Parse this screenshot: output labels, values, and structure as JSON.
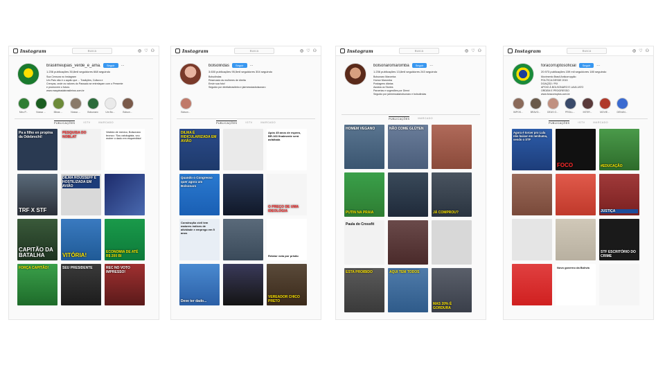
{
  "panels": [
    {
      "app": "Instagram",
      "search": "Busca",
      "username": "brasilmeupais_verde_e_ama...",
      "follow": "Seguir",
      "stats": "1.236 publicações   30,8mil seguidores   668 seguindo",
      "bio": "Sua Censura no Instagram\nUm País não é o aquilo que ... Tradições, Cultura e\nCrenças, onde os valores do Passado se entrelaçam com o Presente\ne promovem o futuro.\nwww.maquinadabrasileiros.com.br",
      "highlights": [
        "Meu P...",
        "Nossa ...",
        "Minas ...",
        "Nossa ...",
        "Bolsonaro",
        "Um Bo...",
        "Bolson..."
      ],
      "tabs": [
        "PUBLICAÇÕES",
        "IGTV",
        "MARCADO"
      ],
      "tiles": [
        {
          "text": "Pa a filho en propina da Odebrecht!",
          "bg": "#2a3a52"
        },
        {
          "text": "PESQUISA DO NOBLAT",
          "bg": "#f2f2f2"
        },
        {
          "text": "Vestido de mexico, Bolsonaro bronco: 'Sou ustologista, vou mober o dado em esquerdista'",
          "bg": "#ffffff"
        },
        {
          "text": "TRF X STF",
          "bg": "#3a3f4a"
        },
        {
          "text": "DILMA ROUSSEFF É HOSTILIZADA EM AVIÃO",
          "bg": "#d9d9d9"
        },
        {
          "text": "",
          "bg": "#1d2b6b"
        },
        {
          "text": "CAPITÃO DA BATALHA",
          "bg": "#1e3320"
        },
        {
          "text": "VITÓRIA!",
          "bg": "#1f5a96"
        },
        {
          "text": "ECONOMIA DE ATÉ R$ 200 BI",
          "bg": "#0d7a3a"
        },
        {
          "text": "FORÇA CAPITÃO!",
          "bg": "#2e8b3a"
        },
        {
          "text": "SEU PRESIDENTE",
          "bg": "#1c1c1c"
        },
        {
          "text": "REC NO VOTO IMPRESSO!",
          "bg": "#7a2020"
        }
      ]
    },
    {
      "app": "Instagram",
      "search": "Busca",
      "username": "bolsolindas",
      "follow": "Seguir",
      "stats": "3.630 publicações   95,5mil seguidores   304 seguindo",
      "bio": "Bolsolindas\nReservado às mulheres de direita\nEnvie sua foto!\nSeguido por direitabrasileira e jairmessiasbolsonaro",
      "highlights": [
        "Bolson..."
      ],
      "tabs": [
        "PUBLICAÇÕES",
        "IGTV",
        "MARCADO"
      ],
      "tiles": [
        {
          "text": "DILMA É RIDICULARIZADA EM AVIÃO",
          "bg": "#1e3a6b"
        },
        {
          "text": "",
          "bg": "#eaeaea"
        },
        {
          "text": "Após 45 anos de espera, BR-163 finalmente será asfaltada",
          "bg": "#ffffff"
        },
        {
          "text": "Quando o Congresso quer agora um Bolsonaro",
          "bg": "#1a5fb4"
        },
        {
          "text": "",
          "bg": "#101828"
        },
        {
          "text": "O PREÇO DE UMA IDEOLOGIA",
          "bg": "#f5f5f5"
        },
        {
          "text": "Construção civil tem maiores índices de atividade e emprego em 5 anos",
          "bg": "#e8eef5"
        },
        {
          "text": "",
          "bg": "#3a4a5a"
        },
        {
          "text": "Relator vota por prisão",
          "bg": "#ffffff"
        },
        {
          "text": "Deve ter dado...",
          "bg": "#2b5fa6"
        },
        {
          "text": "",
          "bg": "#141414"
        },
        {
          "text": "VEREADOR CHICO PRETO",
          "bg": "#3b2a1a"
        }
      ]
    },
    {
      "app": "Instagram",
      "search": "Busca",
      "username": "bolsonaromaromba",
      "follow": "Seguir",
      "stats": "1.236 publicações   13,8mil seguidores   243 seguindo",
      "bio": "Bolsonaro Maromba\nHumor Maromba\nPostagens diárias\nAssista os Stories\nParcerias e sugestões por Direct\nSeguido por jairmessiasbolsonaro e bolsolindas",
      "highlights": [],
      "tabs": [
        "PUBLICAÇÕES",
        "MARCADO"
      ],
      "tiles": [
        {
          "text": "HOMEM VEGANO",
          "bg": "#3a5570"
        },
        {
          "text": "NÃO COME GLÚTEN",
          "bg": "#4a5d7a"
        },
        {
          "text": "",
          "bg": "#8a4a3a"
        },
        {
          "text": "PUTIN NA PRAIA",
          "bg": "#2e7d32"
        },
        {
          "text": "",
          "bg": "#1f2a3a"
        },
        {
          "text": "JÁ COMPROU?",
          "bg": "#2a3440"
        },
        {
          "text": "Paula do Crossfit",
          "bg": "#f2f2f2"
        },
        {
          "text": "",
          "bg": "#4a2a2a"
        },
        {
          "text": "",
          "bg": "#d8d8d8"
        },
        {
          "text": "ESTA PROIBIDO",
          "bg": "#3a3a3a"
        },
        {
          "text": "AQUI TEM TODOS",
          "bg": "#2f5b8a"
        },
        {
          "text": "MAS 20% É GORDURA",
          "bg": "#3a3f4a"
        }
      ]
    },
    {
      "app": "Instagram",
      "search": "Busca",
      "username": "foracorruptosoficial",
      "follow": "Seguir",
      "stats": "20.973 publicações   159 mil seguidores   180 seguindo",
      "bio": "Movimento Brasil Anticorrupção\nPOLÍTICA DESDE 2015\nDOAÇÃO / PIX\nAPOIO À BOLSONARO E LAVA JATO\nORDEM E PROGRESSO\nwww.foracorruptos.com.br",
      "highlights": [
        "IMPOS...",
        "BRAVO...",
        "DEUS O...",
        "PROLL...",
        "INTER...",
        "MOVIE...",
        "DENUN..."
      ],
      "tabs": [
        "PUBLICAÇÕES",
        "IGTV",
        "MARCADO"
      ],
      "tiles": [
        {
          "text": "Agora é torcer pro Lula não baixar em nenhuma, sendo o STF",
          "bg": "#1d3d7a"
        },
        {
          "text": "FOCO",
          "bg": "#111111"
        },
        {
          "text": "#EDUCAÇÃO",
          "bg": "#2d6b2a"
        },
        {
          "text": "",
          "bg": "#7a4a3a"
        },
        {
          "text": "",
          "bg": "#c0392b"
        },
        {
          "text": "JUSTIÇA",
          "bg": "#7a2020"
        },
        {
          "text": "",
          "bg": "#e5e5e5"
        },
        {
          "text": "",
          "bg": "#b8b0a0"
        },
        {
          "text": "STF ESCRITÓRIO DO CRIME",
          "bg": "#1a1a1a"
        },
        {
          "text": "",
          "bg": "#d02020"
        },
        {
          "text": "Novo governo da Bolívia",
          "bg": "#ffffff"
        },
        {
          "text": "",
          "bg": "#f5f5f5"
        }
      ]
    }
  ]
}
